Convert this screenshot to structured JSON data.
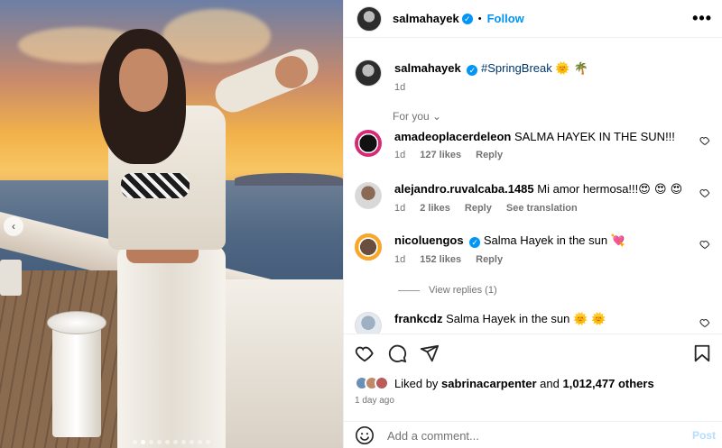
{
  "header": {
    "username": "salmahayek",
    "separator": "•",
    "follow_label": "Follow",
    "more_label": "•••"
  },
  "caption": {
    "username": "salmahayek",
    "text": "#SpringBreak",
    "emoji": "🌞 🌴",
    "time": "1d"
  },
  "for_you_label": "For you",
  "comments": [
    {
      "username": "amadeoplacerdeleon",
      "text": "SALMA HAYEK IN THE SUN!!!",
      "time": "1d",
      "likes": "127 likes",
      "reply": "Reply",
      "extra": ""
    },
    {
      "username": "alejandro.ruvalcaba.1485",
      "text": "Mi amor hermosa!!!",
      "emoji": "😍 😍 😍",
      "time": "1d",
      "likes": "2 likes",
      "reply": "Reply",
      "extra": "See translation"
    },
    {
      "username": "nicoluengos",
      "text": "Salma Hayek in the sun",
      "emoji": "💘",
      "time": "1d",
      "likes": "152 likes",
      "reply": "Reply",
      "extra": ""
    },
    {
      "username": "frankcdz",
      "text": "Salma Hayek in the sun",
      "emoji": "🌞 🌞",
      "time": "",
      "likes": "",
      "reply": "",
      "extra": ""
    }
  ],
  "view_replies": "View replies (1)",
  "likes": {
    "prefix": "Liked by",
    "user": "sabrinacarpenter",
    "and": "and",
    "count": "1,012,477 others"
  },
  "time_ago": "1 day ago",
  "comment_box": {
    "placeholder": "Add a comment...",
    "post_label": "Post"
  },
  "colors": {
    "accent": "#0095f6",
    "muted": "#737373",
    "hashtag": "#00376b"
  },
  "carousel": {
    "active_slide": 1,
    "slides": 10,
    "prev_icon": "chevron-left-icon"
  }
}
